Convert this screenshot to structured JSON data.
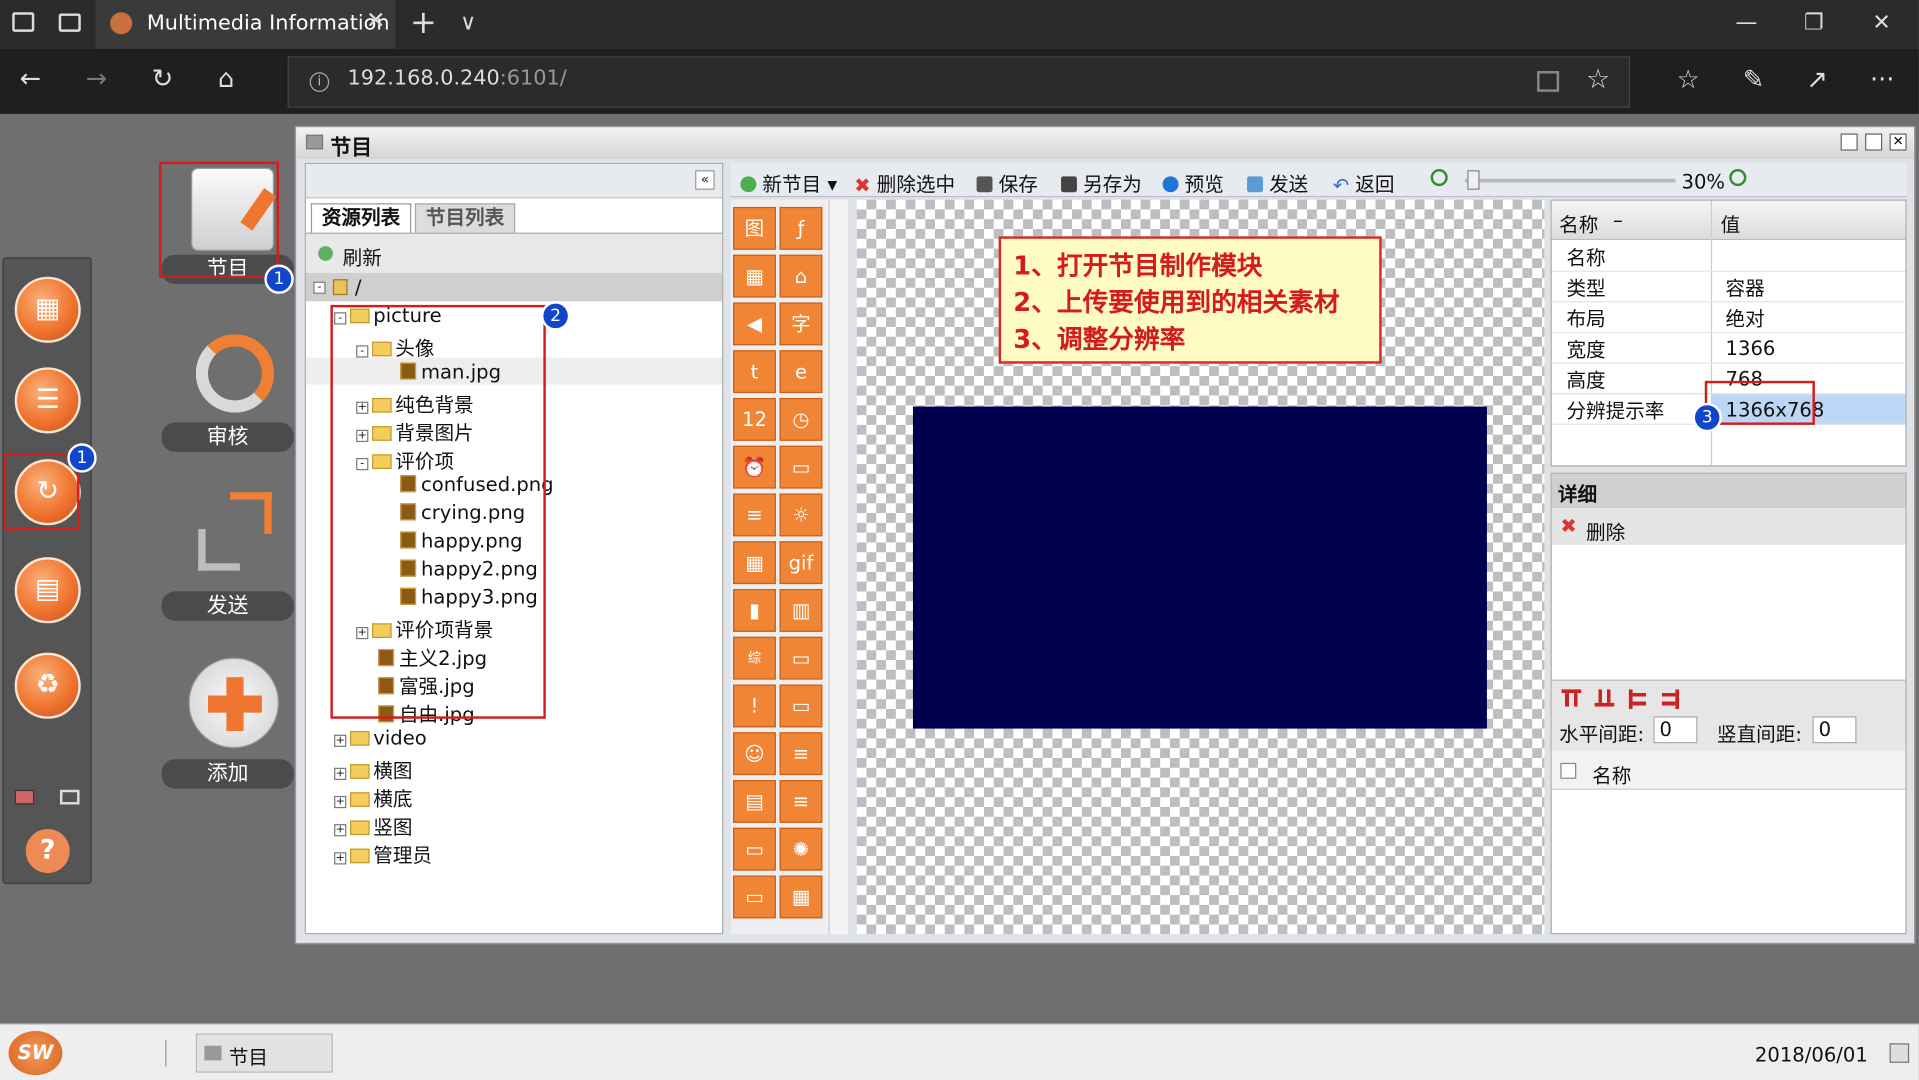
{
  "browser": {
    "tab_title": "Multimedia Information",
    "tab_close": "✕",
    "new_tab": "+",
    "tab_list": "∨",
    "url_host": "192.168.0.240",
    "url_rest": ":6101/",
    "back_icon": "arrow-left",
    "forward_icon": "arrow-right",
    "refresh_icon": "refresh",
    "home_icon": "home",
    "minimize": "—",
    "restore": "❐",
    "close": "✕",
    "more": "···"
  },
  "app": {
    "window_title": "节目",
    "big_buttons": [
      {
        "label": "节目"
      },
      {
        "label": "审核"
      },
      {
        "label": "发送"
      },
      {
        "label": "添加"
      }
    ],
    "resource_tabs": [
      "资源列表",
      "节目列表"
    ],
    "refresh": "刷新",
    "root_path": "/",
    "tree": [
      {
        "label": "picture",
        "kind": "folder",
        "expanded": true
      },
      {
        "label": "头像",
        "kind": "folder",
        "expanded": true
      },
      {
        "label": "man.jpg",
        "kind": "file"
      },
      {
        "label": "纯色背景",
        "kind": "folder"
      },
      {
        "label": "背景图片",
        "kind": "folder"
      },
      {
        "label": "评价项",
        "kind": "folder",
        "expanded": true
      },
      {
        "label": "confused.png",
        "kind": "file"
      },
      {
        "label": "crying.png",
        "kind": "file"
      },
      {
        "label": "happy.png",
        "kind": "file"
      },
      {
        "label": "happy2.png",
        "kind": "file"
      },
      {
        "label": "happy3.png",
        "kind": "file"
      },
      {
        "label": "评价项背景",
        "kind": "folder"
      },
      {
        "label": "主义2.jpg",
        "kind": "file"
      },
      {
        "label": "富强.jpg",
        "kind": "file"
      },
      {
        "label": "自由.jpg",
        "kind": "file"
      },
      {
        "label": "video",
        "kind": "folder"
      },
      {
        "label": "横图",
        "kind": "folder"
      },
      {
        "label": "横底",
        "kind": "folder"
      },
      {
        "label": "竖图",
        "kind": "folder"
      },
      {
        "label": "管理员",
        "kind": "folder"
      }
    ],
    "toolbar": {
      "new_program": "新节目",
      "delete_selected": "删除选中",
      "save": "保存",
      "save_as": "另存为",
      "preview": "预览",
      "send": "发送",
      "back": "返回",
      "zoom": "30%"
    },
    "annotation": {
      "line1": "1、打开节目制作模块",
      "line2": "2、上传要使用到的相关素材",
      "line3": "3、调整分辨率"
    },
    "badges": [
      "1",
      "1",
      "2",
      "3"
    ],
    "canvas_color": "#000050",
    "props": {
      "col_name": "名称",
      "col_value": "值",
      "rows": [
        {
          "name": "名称",
          "value": ""
        },
        {
          "name": "类型",
          "value": "容器"
        },
        {
          "name": "布局",
          "value": "绝对"
        },
        {
          "name": "宽度",
          "value": "1366"
        },
        {
          "name": "高度",
          "value": "768"
        },
        {
          "name": "分辨提示率",
          "value": "1366x768"
        }
      ]
    },
    "detail": {
      "title": "详细",
      "delete": "删除",
      "h_gap_label": "水平间距:",
      "h_gap_value": "0",
      "v_gap_label": "竖直间距:",
      "v_gap_value": "0",
      "list_header": "名称"
    },
    "palette": [
      "图",
      "ƒ",
      "▦",
      "⌂",
      "◀",
      "字",
      "t",
      "e",
      "12",
      "◷",
      "⏰",
      "▭",
      "≡",
      "☼",
      "▦",
      "gif",
      "▮",
      "▥",
      "综",
      "▭",
      "!",
      "▭",
      "☺",
      "≡",
      "▤",
      "≡",
      "▭",
      "✺",
      "▭",
      "▦"
    ]
  },
  "taskbar": {
    "logo": "SW",
    "task_label": "节目",
    "date": "2018/06/01"
  },
  "colors": {
    "accent": "#ef7530",
    "annotation_red": "#d51c1c",
    "badge_blue": "#1146cc",
    "canvas": "#000050"
  }
}
